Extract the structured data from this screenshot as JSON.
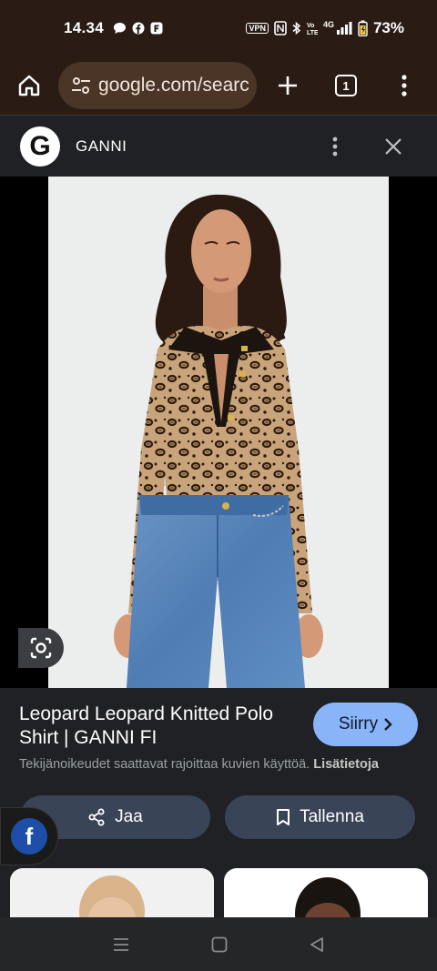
{
  "status": {
    "time": "14.34",
    "vpn": "VPN",
    "network": "4G",
    "battery": "73%"
  },
  "browser": {
    "url": "google.com/searc",
    "tab_count": "1"
  },
  "sheet": {
    "site_initial": "G",
    "site_name": "GANNI"
  },
  "result": {
    "title": "Leopard Leopard Knitted Polo Shirt | GANNI FI",
    "visit_label": "Siirry",
    "copyright_text": "Tekijänoikeudet saattavat rajoittaa kuvien käyttöä.",
    "learn_more": "Lisätietoja"
  },
  "actions": {
    "share_label": "Jaa",
    "save_label": "Tallenna"
  },
  "bubble": {
    "letter": "f"
  },
  "colors": {
    "toolbar_bg": "#2a1c14",
    "sheet_bg": "#202124",
    "visit_button": "#8ab4f8",
    "action_button": "#394457"
  }
}
